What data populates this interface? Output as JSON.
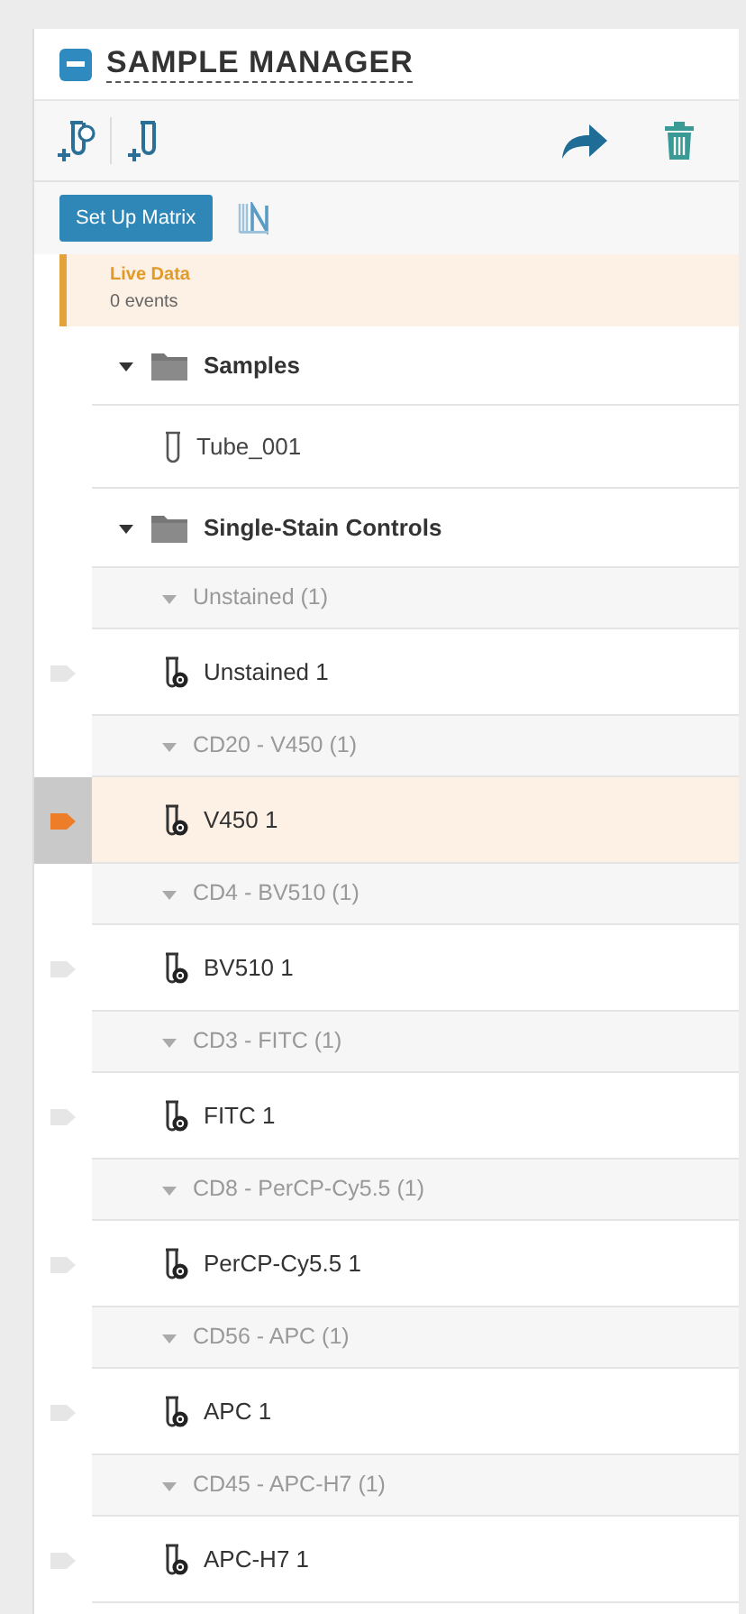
{
  "panel": {
    "title": "SAMPLE MANAGER",
    "expanded": true
  },
  "actions": {
    "setup_button": "Set Up Matrix"
  },
  "live_data": {
    "label": "Live Data",
    "events": "0 events"
  },
  "tree": [
    {
      "kind": "folder",
      "label": "Samples",
      "expanded": true,
      "children": [
        {
          "kind": "tube",
          "label": "Tube_001"
        }
      ]
    },
    {
      "kind": "folder",
      "label": "Single-Stain Controls",
      "expanded": true,
      "children": [
        {
          "kind": "group",
          "label": "Unstained (1)",
          "expanded": true,
          "children": [
            {
              "kind": "control",
              "label": "Unstained 1",
              "selected": false
            }
          ]
        },
        {
          "kind": "group",
          "label": "CD20 - V450 (1)",
          "expanded": true,
          "children": [
            {
              "kind": "control",
              "label": "V450 1",
              "selected": true
            }
          ]
        },
        {
          "kind": "group",
          "label": "CD4 - BV510 (1)",
          "expanded": true,
          "children": [
            {
              "kind": "control",
              "label": "BV510 1",
              "selected": false
            }
          ]
        },
        {
          "kind": "group",
          "label": "CD3 - FITC (1)",
          "expanded": true,
          "children": [
            {
              "kind": "control",
              "label": "FITC 1",
              "selected": false
            }
          ]
        },
        {
          "kind": "group",
          "label": "CD8 - PerCP-Cy5.5 (1)",
          "expanded": true,
          "children": [
            {
              "kind": "control",
              "label": "PerCP-Cy5.5 1",
              "selected": false
            }
          ]
        },
        {
          "kind": "group",
          "label": "CD56 - APC (1)",
          "expanded": true,
          "children": [
            {
              "kind": "control",
              "label": "APC 1",
              "selected": false
            }
          ]
        },
        {
          "kind": "group",
          "label": "CD45 - APC-H7 (1)",
          "expanded": true,
          "children": [
            {
              "kind": "control",
              "label": "APC-H7 1",
              "selected": false
            }
          ]
        }
      ]
    }
  ]
}
